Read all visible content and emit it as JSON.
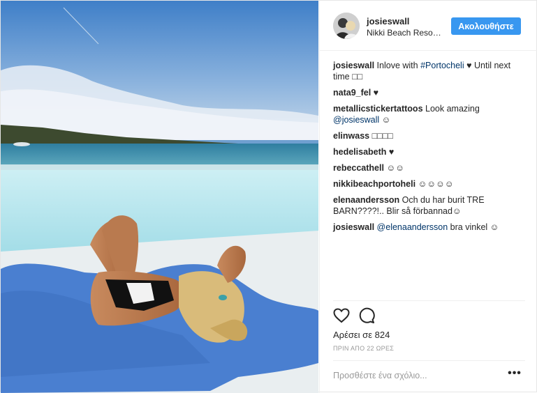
{
  "header": {
    "username": "josieswall",
    "location": "Nikki Beach Resort Porto Heli",
    "follow_label": "Ακολουθήστε"
  },
  "comments": [
    {
      "user": "josieswall",
      "parts": [
        {
          "t": " Inlove with "
        },
        {
          "t": "#Portocheli",
          "link": true
        },
        {
          "t": " ♥ Until next time □□"
        }
      ]
    },
    {
      "user": "nata9_fel",
      "parts": [
        {
          "t": " ♥"
        }
      ]
    },
    {
      "user": "metallicstickertattoos",
      "parts": [
        {
          "t": " Look amazing "
        },
        {
          "t": "@josieswall",
          "link": true
        },
        {
          "t": " ☺"
        }
      ]
    },
    {
      "user": "elinwass",
      "parts": [
        {
          "t": " □□□□"
        }
      ]
    },
    {
      "user": "hedelisabeth",
      "parts": [
        {
          "t": " ♥"
        }
      ]
    },
    {
      "user": "rebeccathell",
      "parts": [
        {
          "t": " ☺☺"
        }
      ]
    },
    {
      "user": "nikkibeachportoheli",
      "parts": [
        {
          "t": " ☺☺☺☺"
        }
      ]
    },
    {
      "user": "elenaandersson",
      "parts": [
        {
          "t": " Och du har burit TRE BARN????!.. Blir så förbannad☺"
        }
      ]
    },
    {
      "user": "josieswall",
      "parts": [
        {
          "t": " "
        },
        {
          "t": "@elenaandersson",
          "link": true
        },
        {
          "t": " bra vinkel ☺"
        }
      ]
    }
  ],
  "actions": {
    "like_icon": "heart-outline-icon",
    "comment_icon": "speech-bubble-icon",
    "likes_text": "Αρέσει σε 824",
    "time_text": "ΠΡΙΝ ΑΠΟ 22 ΩΡΕΣ"
  },
  "composer": {
    "placeholder": "Προσθέστε ένα σχόλιο...",
    "more_label": "•••"
  },
  "colors": {
    "accent": "#3897f0",
    "link": "#003569"
  }
}
